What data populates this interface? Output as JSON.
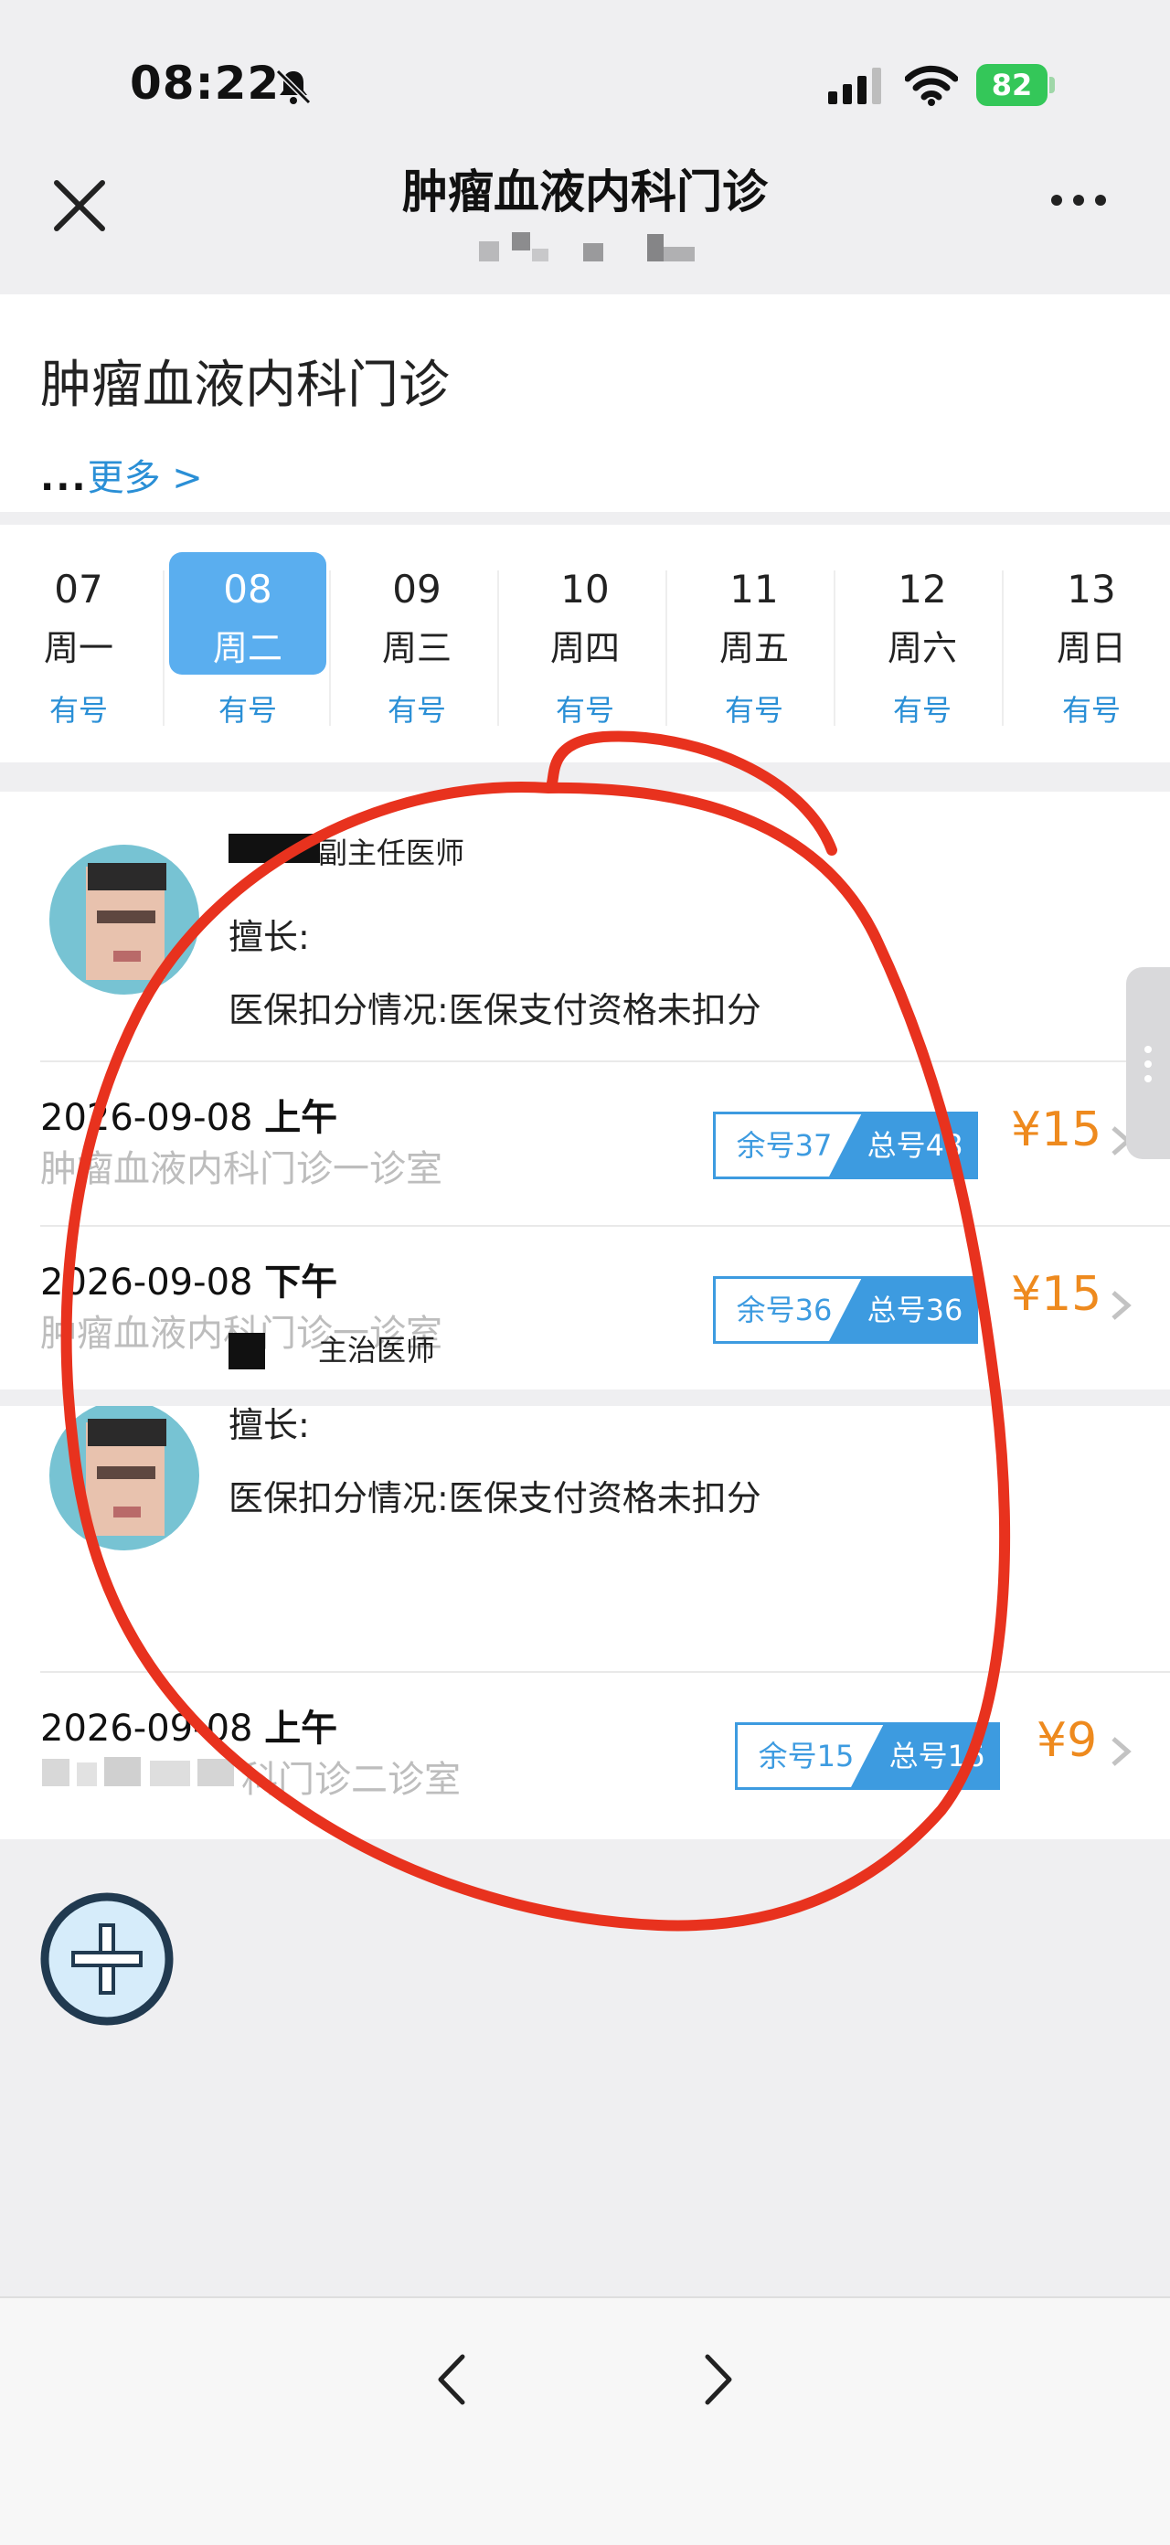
{
  "status_bar": {
    "time": "08:22",
    "battery": "82"
  },
  "header": {
    "title": "肿瘤血液内科门诊"
  },
  "department": {
    "name": "肿瘤血液内科门诊",
    "more_dots": "...",
    "more_link": "更多 >"
  },
  "dates": [
    {
      "day": "07",
      "weekday": "周一",
      "status": "有号",
      "selected": false
    },
    {
      "day": "08",
      "weekday": "周二",
      "status": "有号",
      "selected": true
    },
    {
      "day": "09",
      "weekday": "周三",
      "status": "有号",
      "selected": false
    },
    {
      "day": "10",
      "weekday": "周四",
      "status": "有号",
      "selected": false
    },
    {
      "day": "11",
      "weekday": "周五",
      "status": "有号",
      "selected": false
    },
    {
      "day": "12",
      "weekday": "周六",
      "status": "有号",
      "selected": false
    },
    {
      "day": "13",
      "weekday": "周日",
      "status": "有号",
      "selected": false
    }
  ],
  "doctors": [
    {
      "title": "副主任医师",
      "specialty": "擅长:",
      "insurance": "医保扣分情况:医保支付资格未扣分",
      "slots": [
        {
          "date": "2026-09-08",
          "period": "上午",
          "room": "肿瘤血液内科门诊一诊室",
          "remaining": "余号37",
          "total": "总号48",
          "price": "¥15"
        },
        {
          "date": "2026-09-08",
          "period": "下午",
          "room": "肿瘤血液内科门诊一诊室",
          "remaining": "余号36",
          "total": "总号36",
          "price": "¥15"
        }
      ]
    },
    {
      "title": "主治医师",
      "specialty": "擅长:",
      "insurance": "医保扣分情况:医保支付资格未扣分",
      "slots": [
        {
          "date": "2026-09-08",
          "period": "上午",
          "room": "科门诊二诊室",
          "remaining": "余号15",
          "total": "总号16",
          "price": "¥9"
        }
      ]
    }
  ],
  "colors": {
    "accent": "#3d9be0",
    "selected_date": "#5aaeef",
    "price": "#ee8a1e",
    "annotation": "#e8321e",
    "battery": "#34c759"
  },
  "icons": {
    "close": "close-icon",
    "more": "more-dots-icon",
    "add": "add-icon",
    "back": "chevron-left-icon",
    "forward": "chevron-right-icon"
  }
}
